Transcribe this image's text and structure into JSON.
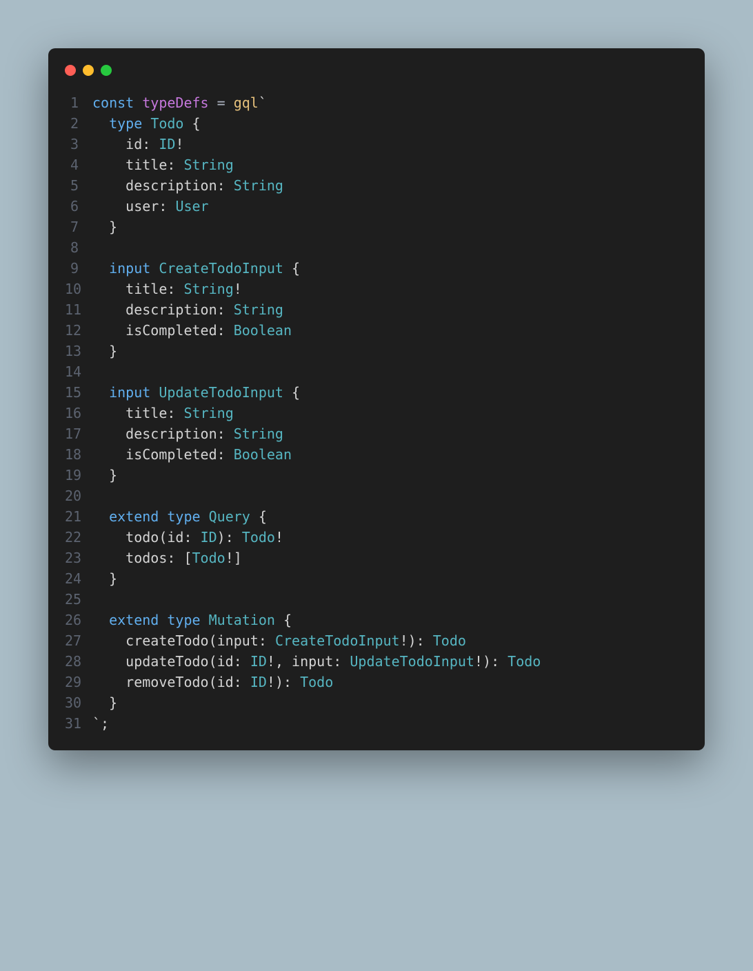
{
  "code": {
    "lines": [
      {
        "num": "1",
        "tokens": [
          {
            "t": "const ",
            "c": "kw"
          },
          {
            "t": "typeDefs",
            "c": "name"
          },
          {
            "t": " = ",
            "c": "op"
          },
          {
            "t": "gql",
            "c": "fn"
          },
          {
            "t": "`",
            "c": "white"
          }
        ]
      },
      {
        "num": "2",
        "tokens": [
          {
            "t": "  ",
            "c": "white"
          },
          {
            "t": "type",
            "c": "kw"
          },
          {
            "t": " ",
            "c": "white"
          },
          {
            "t": "Todo",
            "c": "type"
          },
          {
            "t": " {",
            "c": "white"
          }
        ]
      },
      {
        "num": "3",
        "tokens": [
          {
            "t": "    ",
            "c": "white"
          },
          {
            "t": "id",
            "c": "field"
          },
          {
            "t": ": ",
            "c": "white"
          },
          {
            "t": "ID",
            "c": "type"
          },
          {
            "t": "!",
            "c": "white"
          }
        ]
      },
      {
        "num": "4",
        "tokens": [
          {
            "t": "    ",
            "c": "white"
          },
          {
            "t": "title",
            "c": "field"
          },
          {
            "t": ": ",
            "c": "white"
          },
          {
            "t": "String",
            "c": "type"
          }
        ]
      },
      {
        "num": "5",
        "tokens": [
          {
            "t": "    ",
            "c": "white"
          },
          {
            "t": "description",
            "c": "field"
          },
          {
            "t": ": ",
            "c": "white"
          },
          {
            "t": "String",
            "c": "type"
          }
        ]
      },
      {
        "num": "6",
        "tokens": [
          {
            "t": "    ",
            "c": "white"
          },
          {
            "t": "user",
            "c": "field"
          },
          {
            "t": ": ",
            "c": "white"
          },
          {
            "t": "User",
            "c": "type"
          }
        ]
      },
      {
        "num": "7",
        "tokens": [
          {
            "t": "  }",
            "c": "white"
          }
        ]
      },
      {
        "num": "8",
        "tokens": []
      },
      {
        "num": "9",
        "tokens": [
          {
            "t": "  ",
            "c": "white"
          },
          {
            "t": "input",
            "c": "kw"
          },
          {
            "t": " ",
            "c": "white"
          },
          {
            "t": "CreateTodoInput",
            "c": "type"
          },
          {
            "t": " {",
            "c": "white"
          }
        ]
      },
      {
        "num": "10",
        "tokens": [
          {
            "t": "    ",
            "c": "white"
          },
          {
            "t": "title",
            "c": "field"
          },
          {
            "t": ": ",
            "c": "white"
          },
          {
            "t": "String",
            "c": "type"
          },
          {
            "t": "!",
            "c": "white"
          }
        ]
      },
      {
        "num": "11",
        "tokens": [
          {
            "t": "    ",
            "c": "white"
          },
          {
            "t": "description",
            "c": "field"
          },
          {
            "t": ": ",
            "c": "white"
          },
          {
            "t": "String",
            "c": "type"
          }
        ]
      },
      {
        "num": "12",
        "tokens": [
          {
            "t": "    ",
            "c": "white"
          },
          {
            "t": "isCompleted",
            "c": "field"
          },
          {
            "t": ": ",
            "c": "white"
          },
          {
            "t": "Boolean",
            "c": "type"
          }
        ]
      },
      {
        "num": "13",
        "tokens": [
          {
            "t": "  }",
            "c": "white"
          }
        ]
      },
      {
        "num": "14",
        "tokens": []
      },
      {
        "num": "15",
        "tokens": [
          {
            "t": "  ",
            "c": "white"
          },
          {
            "t": "input",
            "c": "kw"
          },
          {
            "t": " ",
            "c": "white"
          },
          {
            "t": "UpdateTodoInput",
            "c": "type"
          },
          {
            "t": " {",
            "c": "white"
          }
        ]
      },
      {
        "num": "16",
        "tokens": [
          {
            "t": "    ",
            "c": "white"
          },
          {
            "t": "title",
            "c": "field"
          },
          {
            "t": ": ",
            "c": "white"
          },
          {
            "t": "String",
            "c": "type"
          }
        ]
      },
      {
        "num": "17",
        "tokens": [
          {
            "t": "    ",
            "c": "white"
          },
          {
            "t": "description",
            "c": "field"
          },
          {
            "t": ": ",
            "c": "white"
          },
          {
            "t": "String",
            "c": "type"
          }
        ]
      },
      {
        "num": "18",
        "tokens": [
          {
            "t": "    ",
            "c": "white"
          },
          {
            "t": "isCompleted",
            "c": "field"
          },
          {
            "t": ": ",
            "c": "white"
          },
          {
            "t": "Boolean",
            "c": "type"
          }
        ]
      },
      {
        "num": "19",
        "tokens": [
          {
            "t": "  }",
            "c": "white"
          }
        ]
      },
      {
        "num": "20",
        "tokens": []
      },
      {
        "num": "21",
        "tokens": [
          {
            "t": "  ",
            "c": "white"
          },
          {
            "t": "extend",
            "c": "kw"
          },
          {
            "t": " ",
            "c": "white"
          },
          {
            "t": "type",
            "c": "kw"
          },
          {
            "t": " ",
            "c": "white"
          },
          {
            "t": "Query",
            "c": "type"
          },
          {
            "t": " {",
            "c": "white"
          }
        ]
      },
      {
        "num": "22",
        "tokens": [
          {
            "t": "    ",
            "c": "white"
          },
          {
            "t": "todo",
            "c": "field"
          },
          {
            "t": "(",
            "c": "white"
          },
          {
            "t": "id",
            "c": "field"
          },
          {
            "t": ": ",
            "c": "white"
          },
          {
            "t": "ID",
            "c": "type"
          },
          {
            "t": "): ",
            "c": "white"
          },
          {
            "t": "Todo",
            "c": "type"
          },
          {
            "t": "!",
            "c": "white"
          }
        ]
      },
      {
        "num": "23",
        "tokens": [
          {
            "t": "    ",
            "c": "white"
          },
          {
            "t": "todos",
            "c": "field"
          },
          {
            "t": ": [",
            "c": "white"
          },
          {
            "t": "Todo",
            "c": "type"
          },
          {
            "t": "!]",
            "c": "white"
          }
        ]
      },
      {
        "num": "24",
        "tokens": [
          {
            "t": "  }",
            "c": "white"
          }
        ]
      },
      {
        "num": "25",
        "tokens": []
      },
      {
        "num": "26",
        "tokens": [
          {
            "t": "  ",
            "c": "white"
          },
          {
            "t": "extend",
            "c": "kw"
          },
          {
            "t": " ",
            "c": "white"
          },
          {
            "t": "type",
            "c": "kw"
          },
          {
            "t": " ",
            "c": "white"
          },
          {
            "t": "Mutation",
            "c": "type"
          },
          {
            "t": " {",
            "c": "white"
          }
        ]
      },
      {
        "num": "27",
        "tokens": [
          {
            "t": "    ",
            "c": "white"
          },
          {
            "t": "createTodo",
            "c": "field"
          },
          {
            "t": "(",
            "c": "white"
          },
          {
            "t": "input",
            "c": "field"
          },
          {
            "t": ": ",
            "c": "white"
          },
          {
            "t": "CreateTodoInput",
            "c": "type"
          },
          {
            "t": "!): ",
            "c": "white"
          },
          {
            "t": "Todo",
            "c": "type"
          }
        ]
      },
      {
        "num": "28",
        "tokens": [
          {
            "t": "    ",
            "c": "white"
          },
          {
            "t": "updateTodo",
            "c": "field"
          },
          {
            "t": "(",
            "c": "white"
          },
          {
            "t": "id",
            "c": "field"
          },
          {
            "t": ": ",
            "c": "white"
          },
          {
            "t": "ID",
            "c": "type"
          },
          {
            "t": "!, ",
            "c": "white"
          },
          {
            "t": "input",
            "c": "field"
          },
          {
            "t": ": ",
            "c": "white"
          },
          {
            "t": "UpdateTodoInput",
            "c": "type"
          },
          {
            "t": "!): ",
            "c": "white"
          },
          {
            "t": "Todo",
            "c": "type"
          }
        ]
      },
      {
        "num": "29",
        "tokens": [
          {
            "t": "    ",
            "c": "white"
          },
          {
            "t": "removeTodo",
            "c": "field"
          },
          {
            "t": "(",
            "c": "white"
          },
          {
            "t": "id",
            "c": "field"
          },
          {
            "t": ": ",
            "c": "white"
          },
          {
            "t": "ID",
            "c": "type"
          },
          {
            "t": "!): ",
            "c": "white"
          },
          {
            "t": "Todo",
            "c": "type"
          }
        ]
      },
      {
        "num": "30",
        "tokens": [
          {
            "t": "  }",
            "c": "white"
          }
        ]
      },
      {
        "num": "31",
        "tokens": [
          {
            "t": "`;",
            "c": "white"
          }
        ]
      }
    ]
  }
}
